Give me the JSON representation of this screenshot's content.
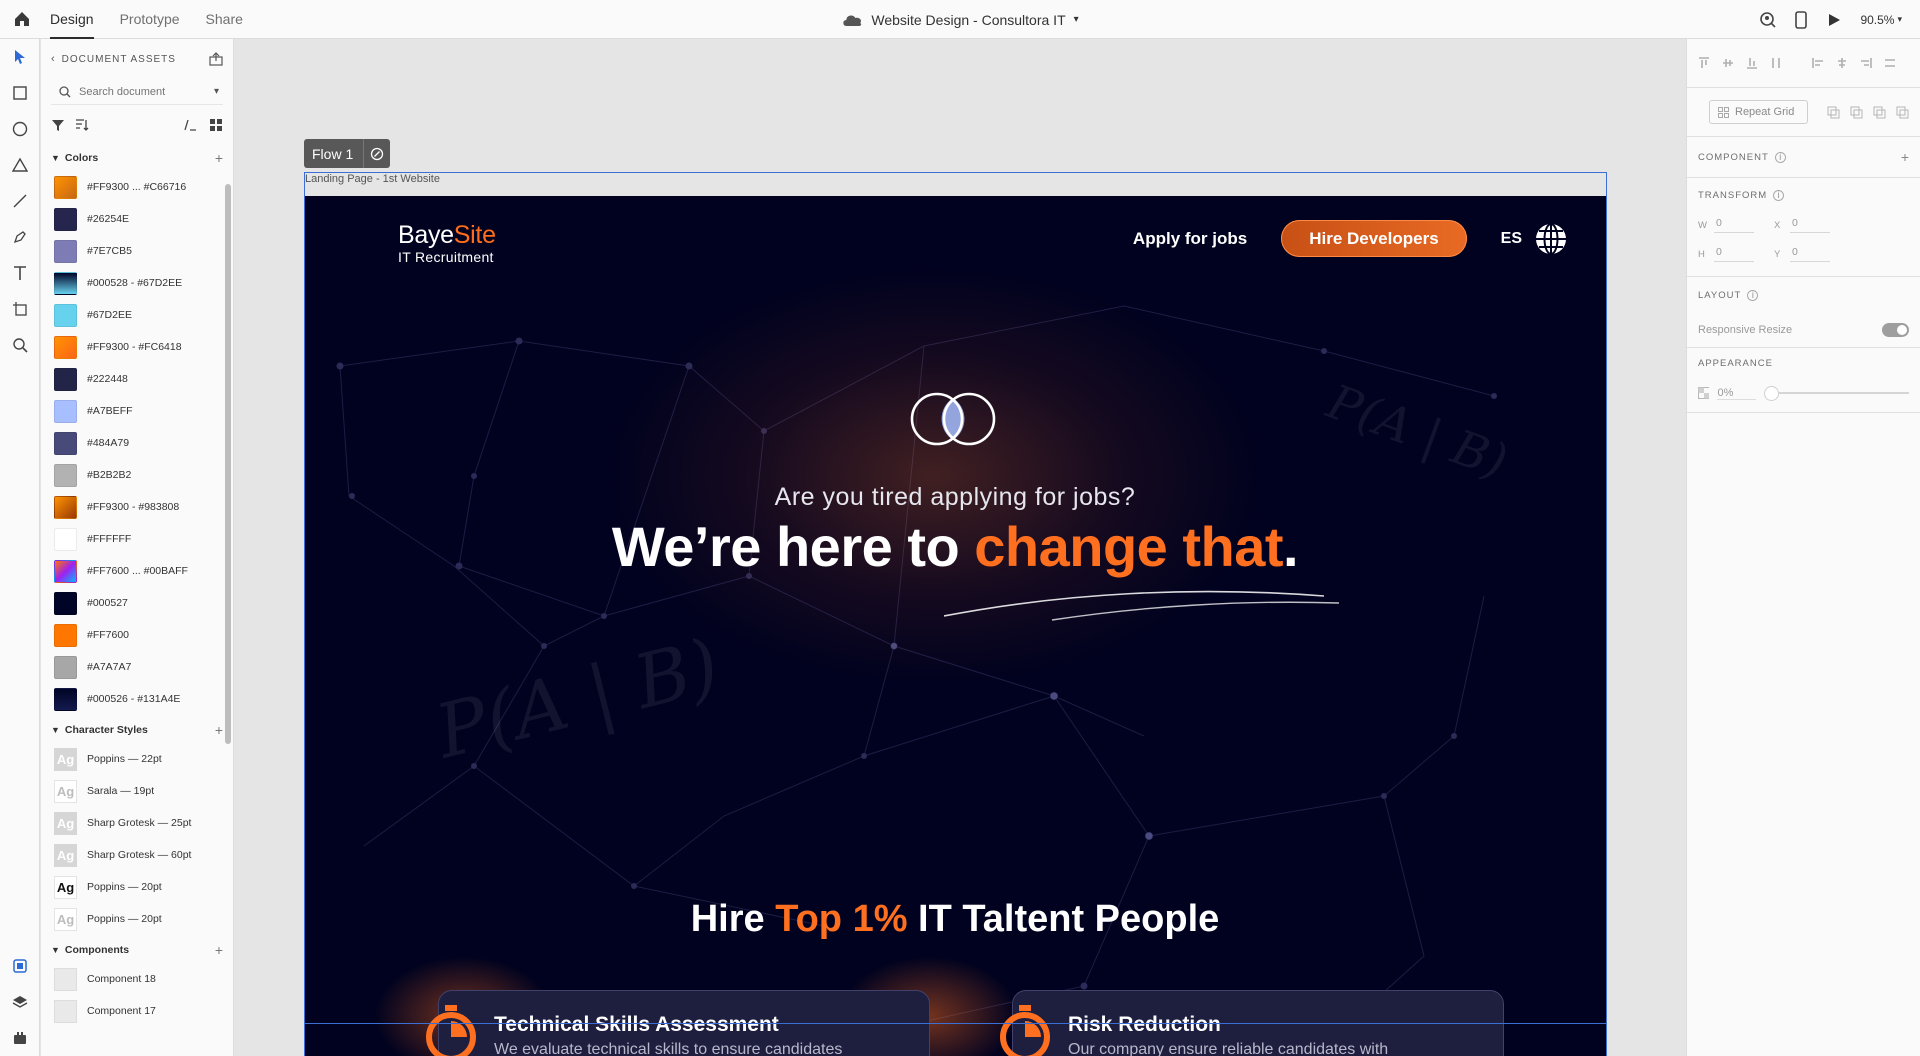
{
  "topbar": {
    "tabs": [
      {
        "label": "Design",
        "active": true
      },
      {
        "label": "Prototype",
        "active": false
      },
      {
        "label": "Share",
        "active": false
      }
    ],
    "doc_title": "Website Design - Consultora IT",
    "zoom": "90.5%"
  },
  "assets": {
    "header": "DOCUMENT ASSETS",
    "search_placeholder": "Search document",
    "colors_title": "Colors",
    "colors": [
      {
        "label": "#FF9300 ... #C66716",
        "fill": "linear-gradient(135deg,#FF9300,#C66716)"
      },
      {
        "label": "#26254E",
        "fill": "#26254E"
      },
      {
        "label": "#7E7CB5",
        "fill": "#7E7CB5"
      },
      {
        "label": "#000528 - #67D2EE",
        "fill": "linear-gradient(180deg,#000528,#67D2EE)"
      },
      {
        "label": "#67D2EE",
        "fill": "#67D2EE"
      },
      {
        "label": "#FF9300 - #FC6418",
        "fill": "linear-gradient(135deg,#FF9300,#FC6418)"
      },
      {
        "label": "#222448",
        "fill": "#222448"
      },
      {
        "label": "#A7BEFF",
        "fill": "#A7BEFF"
      },
      {
        "label": "#484A79",
        "fill": "#484A79"
      },
      {
        "label": "#B2B2B2",
        "fill": "#B2B2B2"
      },
      {
        "label": "#FF9300 - #983808",
        "fill": "linear-gradient(135deg,#FF9300,#983808)"
      },
      {
        "label": "#FFFFFF",
        "fill": "#FFFFFF"
      },
      {
        "label": "#FF7600 ... #00BAFF",
        "fill": "linear-gradient(135deg,#FF7600,#A020F0,#00BAFF)"
      },
      {
        "label": "#000527",
        "fill": "#000527"
      },
      {
        "label": "#FF7600",
        "fill": "#FF7600"
      },
      {
        "label": "#A7A7A7",
        "fill": "#A7A7A7"
      },
      {
        "label": "#000526 - #131A4E",
        "fill": "linear-gradient(180deg,#000526,#131A4E)"
      }
    ],
    "char_styles_title": "Character Styles",
    "char_styles": [
      {
        "label": "Poppins — 22pt",
        "glyph": "Ag",
        "bg": "#d6d6d6",
        "color": "#ffffff"
      },
      {
        "label": "Sarala — 19pt",
        "glyph": "Ag",
        "bg": "#ffffff",
        "color": "#bdbdbd"
      },
      {
        "label": "Sharp Grotesk — 25pt",
        "glyph": "Ag",
        "bg": "#d6d6d6",
        "color": "#ffffff"
      },
      {
        "label": "Sharp Grotesk — 60pt",
        "glyph": "Ag",
        "bg": "#d6d6d6",
        "color": "#ffffff"
      },
      {
        "label": "Poppins — 20pt",
        "glyph": "Ag",
        "bg": "#ffffff",
        "color": "#111111"
      },
      {
        "label": "Poppins — 20pt",
        "glyph": "Ag",
        "bg": "#ffffff",
        "color": "#bdbdbd"
      }
    ],
    "components_title": "Components",
    "components": [
      {
        "label": "Component 18"
      },
      {
        "label": "Component 17"
      }
    ]
  },
  "canvas": {
    "flow_label": "Flow 1",
    "artboard_label": "Landing Page - 1st Website"
  },
  "site": {
    "logo_main": "Baye",
    "logo_accent": "Site",
    "logo_sub": "IT Recruitment",
    "nav_apply": "Apply for jobs",
    "nav_hire": "Hire Developers",
    "nav_lang": "ES",
    "tagline": "Are you tired applying for jobs?",
    "headline_a": "We’re here to ",
    "headline_b": "change that",
    "headline_c": ".",
    "formula": "P(A | B)",
    "section_a": "Hire ",
    "section_b": "Top 1%",
    "section_c": " IT Taltent People",
    "cards": [
      {
        "title": "Technical Skills Assessment",
        "text": "We evaluate technical skills to ensure candidates"
      },
      {
        "title": "Risk Reduction",
        "text": "Our company ensure reliable candidates with"
      }
    ],
    "accent": "#FF6F20",
    "background": "#01021F"
  },
  "inspector": {
    "repeat_grid": "Repeat Grid",
    "component": "COMPONENT",
    "transform": "TRANSFORM",
    "w_label": "W",
    "w": "0",
    "x_label": "X",
    "x": "0",
    "h_label": "H",
    "h": "0",
    "y_label": "Y",
    "y": "0",
    "layout": "LAYOUT",
    "responsive": "Responsive Resize",
    "appearance": "APPEARANCE",
    "opacity": "0%"
  }
}
